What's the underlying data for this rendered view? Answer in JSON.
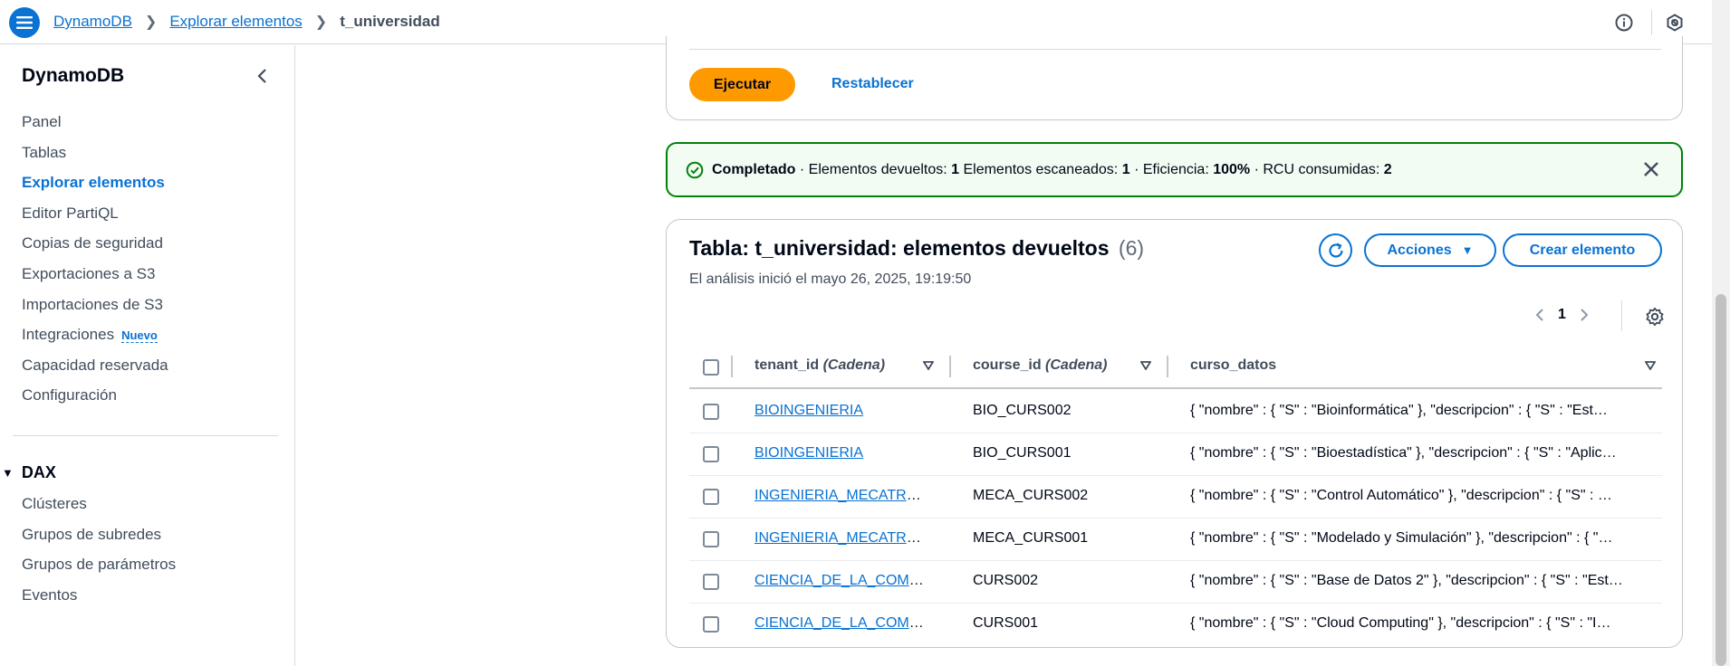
{
  "header": {
    "breadcrumbs": [
      "DynamoDB",
      "Explorar elementos",
      "t_universidad"
    ],
    "icons": [
      "info-icon",
      "notifications-icon"
    ]
  },
  "sidebar": {
    "title": "DynamoDB",
    "items": [
      {
        "label": "Panel"
      },
      {
        "label": "Tablas"
      },
      {
        "label": "Explorar elementos",
        "active": true
      },
      {
        "label": "Editor PartiQL"
      },
      {
        "label": "Copias de seguridad"
      },
      {
        "label": "Exportaciones a S3"
      },
      {
        "label": "Importaciones de S3"
      },
      {
        "label": "Integraciones",
        "badge": "Nuevo"
      },
      {
        "label": "Capacidad reservada"
      },
      {
        "label": "Configuración"
      }
    ],
    "dax": {
      "title": "DAX",
      "items": [
        {
          "label": "Clústeres"
        },
        {
          "label": "Grupos de subredes"
        },
        {
          "label": "Grupos de parámetros"
        },
        {
          "label": "Eventos"
        }
      ]
    }
  },
  "actions": {
    "run_label": "Ejecutar",
    "reset_label": "Restablecer"
  },
  "alert": {
    "status": "Completado",
    "returned_label": "· Elementos devueltos:",
    "returned": "1",
    "scanned_label": "Elementos escaneados:",
    "scanned": "1",
    "efficiency_label": "· Eficiencia:",
    "efficiency": "100%",
    "rcu_label": "· RCU consumidas:",
    "rcu": "2"
  },
  "table": {
    "title": "Tabla: t_universidad: elementos devueltos",
    "count": "(6)",
    "subtitle": "El análisis inició el mayo 26, 2025, 19:19:50",
    "actions_label": "Acciones",
    "create_label": "Crear elemento",
    "page": "1",
    "columns": [
      {
        "name": "tenant_id",
        "type": "(Cadena)"
      },
      {
        "name": "course_id",
        "type": "(Cadena)"
      },
      {
        "name": "curso_datos",
        "type": ""
      }
    ],
    "rows": [
      {
        "tenant_id": "BIOINGENIERIA",
        "course_id": "BIO_CURS002",
        "curso_datos": "{ \"nombre\" : { \"S\" : \"Bioinformática\" }, \"descripcion\" : { \"S\" : \"Est…"
      },
      {
        "tenant_id": "BIOINGENIERIA",
        "course_id": "BIO_CURS001",
        "curso_datos": "{ \"nombre\" : { \"S\" : \"Bioestadística\" }, \"descripcion\" : { \"S\" : \"Aplic…"
      },
      {
        "tenant_id": "INGENIERIA_MECATRO…",
        "course_id": "MECA_CURS002",
        "curso_datos": "{ \"nombre\" : { \"S\" : \"Control Automático\" }, \"descripcion\" : { \"S\" : …"
      },
      {
        "tenant_id": "INGENIERIA_MECATRO…",
        "course_id": "MECA_CURS001",
        "curso_datos": "{ \"nombre\" : { \"S\" : \"Modelado y Simulación\" }, \"descripcion\" : { \"…"
      },
      {
        "tenant_id": "CIENCIA_DE_LA_COMP…",
        "course_id": "CURS002",
        "curso_datos": "{ \"nombre\" : { \"S\" : \"Base de Datos 2\" }, \"descripcion\" : { \"S\" : \"Est…"
      },
      {
        "tenant_id": "CIENCIA_DE_LA_COMP…",
        "course_id": "CURS001",
        "curso_datos": "{ \"nombre\" : { \"S\" : \"Cloud Computing\" }, \"descripcion\" : { \"S\" : \"I…"
      }
    ]
  },
  "colors": {
    "link": "#0972d3",
    "primary_button": "#ff9900",
    "success": "#037f0c"
  }
}
